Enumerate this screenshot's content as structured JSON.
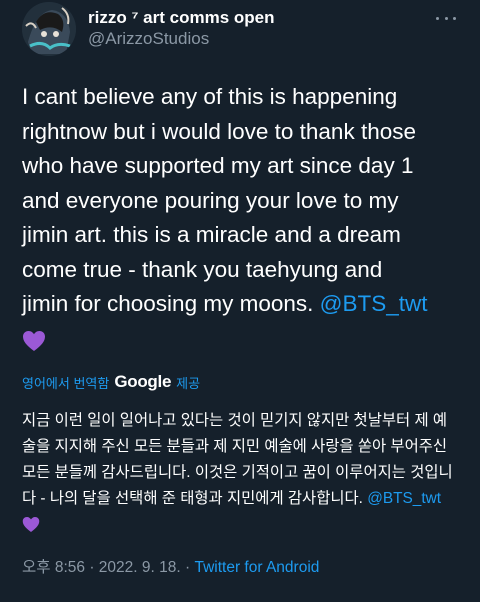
{
  "author": {
    "display_name": "rizzo ⁷ art comms open",
    "handle": "@ArizzoStudios"
  },
  "tweet": {
    "text": "I cant believe any of this is happening\nrightnow but i would love to thank those\nwho have supported my art since day 1\nand everyone pouring your love to my\njimin art. this is a miracle and a dream\ncome true - thank you taehyung and\njimin for choosing my moons. ",
    "mention": "@BTS_twt",
    "emoji": "purple-heart"
  },
  "translation": {
    "label": "영어에서 번역함",
    "provider": "Google",
    "provider_suffix": "제공",
    "text": "지금 이런 일이 일어나고 있다는 것이 믿기지 않지만 첫날부터 제 예\n술을 지지해 주신 모든 분들과 제 지민 예술에 사랑을 쏟아 부어주신\n모든 분들께 감사드립니다. 이것은 기적이고 꿈이 이루어지는 것입니\n다 - 나의 달을 선택해 준 태형과 지민에게 감사합니다. ",
    "mention": "@BTS_twt"
  },
  "meta": {
    "time": "오후 8:56",
    "date": "2022. 9. 18.",
    "separator": "·",
    "source": "Twitter for Android"
  },
  "colors": {
    "background": "#15202b",
    "link": "#1d9bf0",
    "secondary": "#8b98a5",
    "heart": "#9b59d6"
  }
}
